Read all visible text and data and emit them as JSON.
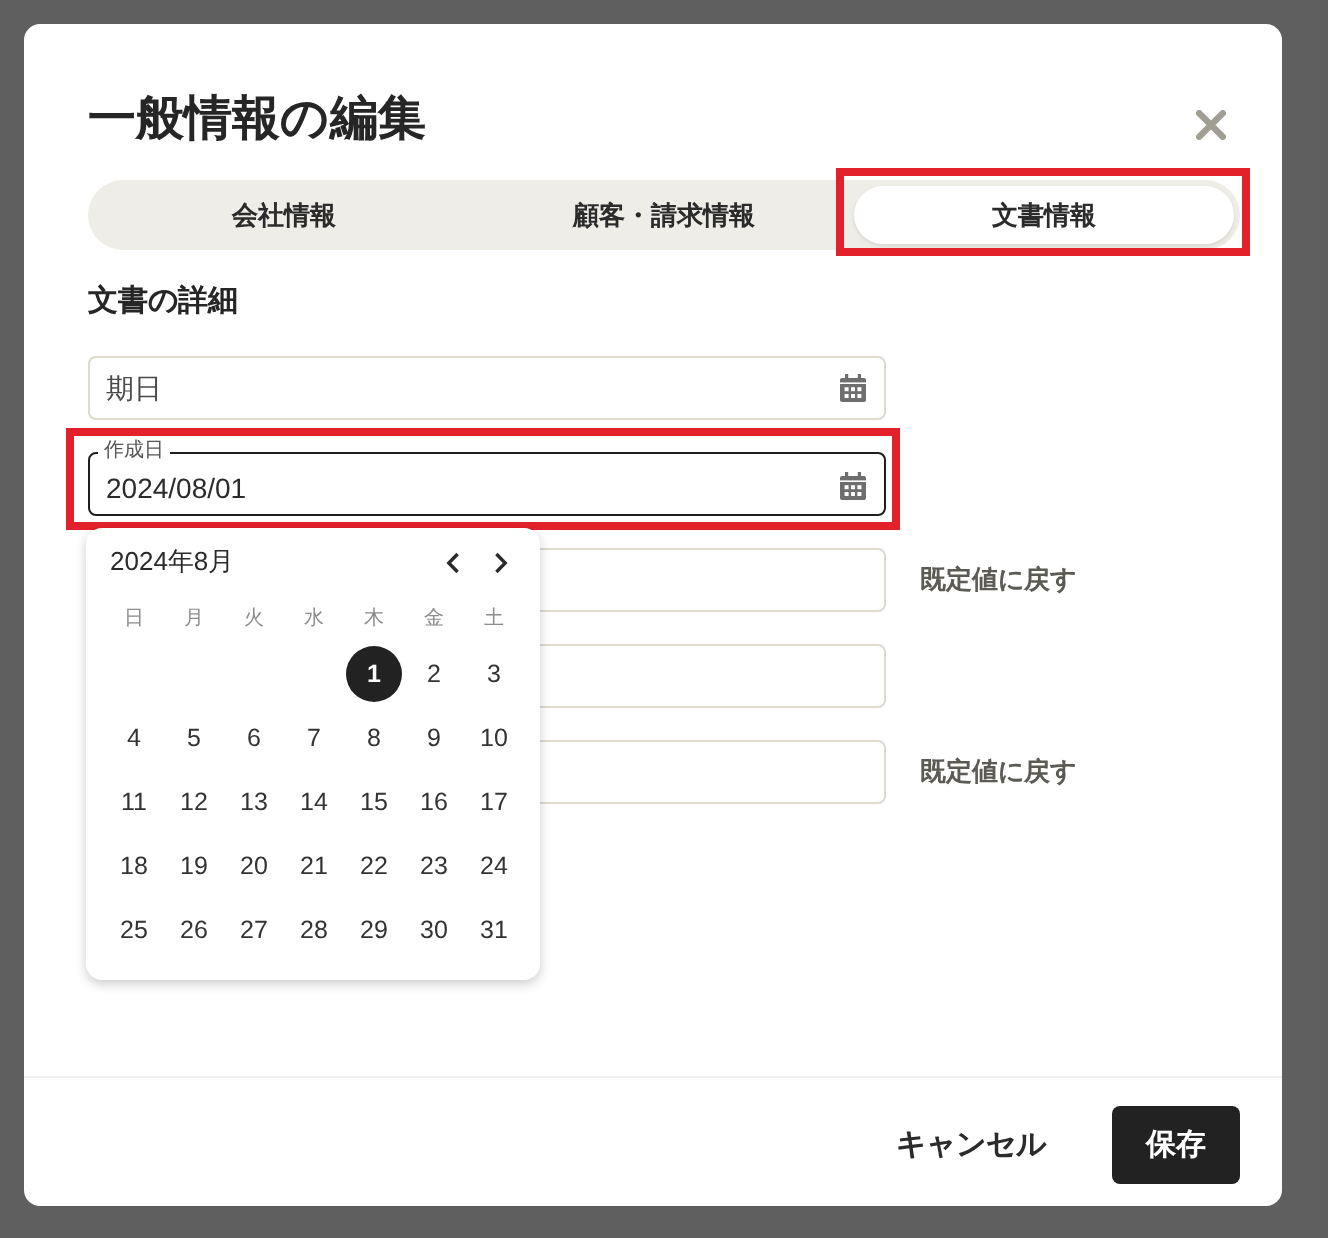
{
  "dialog": {
    "title": "一般情報の編集",
    "tabs": [
      {
        "label": "会社情報",
        "selected": false,
        "highlighted": false
      },
      {
        "label": "顧客・請求情報",
        "selected": false,
        "highlighted": false
      },
      {
        "label": "文書情報",
        "selected": true,
        "highlighted": true
      }
    ],
    "section_title": "文書の詳細",
    "fields": [
      {
        "kind": "date",
        "placeholder": "期日",
        "focused": false,
        "highlighted": false
      },
      {
        "kind": "date",
        "label": "作成日",
        "value": "2024/08/01",
        "focused": true,
        "highlighted": true
      },
      {
        "kind": "text",
        "focused": false,
        "highlighted": false,
        "reset_link": "既定値に戻す"
      },
      {
        "kind": "text",
        "focused": false,
        "highlighted": false
      },
      {
        "kind": "text",
        "focused": false,
        "highlighted": false,
        "reset_link": "既定値に戻す"
      }
    ],
    "date_picker": {
      "month": "2024年8月",
      "weekdays": [
        "日",
        "月",
        "火",
        "水",
        "木",
        "金",
        "土"
      ],
      "weeks": [
        [
          {
            "day": "1",
            "selected": true
          },
          {
            "day": "2",
            "selected": false
          },
          {
            "day": "3",
            "selected": false
          }
        ],
        [
          {
            "day": "4",
            "selected": false
          },
          {
            "day": "5",
            "selected": false
          },
          {
            "day": "6",
            "selected": false
          },
          {
            "day": "7",
            "selected": false
          },
          {
            "day": "8",
            "selected": false
          },
          {
            "day": "9",
            "selected": false
          },
          {
            "day": "10",
            "selected": false
          }
        ],
        [
          {
            "day": "11",
            "selected": false
          },
          {
            "day": "12",
            "selected": false
          },
          {
            "day": "13",
            "selected": false
          },
          {
            "day": "14",
            "selected": false
          },
          {
            "day": "15",
            "selected": false
          },
          {
            "day": "16",
            "selected": false
          },
          {
            "day": "17",
            "selected": false
          }
        ],
        [
          {
            "day": "18",
            "selected": false
          },
          {
            "day": "19",
            "selected": false
          },
          {
            "day": "20",
            "selected": false
          },
          {
            "day": "21",
            "selected": false
          },
          {
            "day": "22",
            "selected": false
          },
          {
            "day": "23",
            "selected": false
          },
          {
            "day": "24",
            "selected": false
          }
        ],
        [
          {
            "day": "25",
            "selected": false
          },
          {
            "day": "26",
            "selected": false
          },
          {
            "day": "27",
            "selected": false
          },
          {
            "day": "28",
            "selected": false
          },
          {
            "day": "29",
            "selected": false
          },
          {
            "day": "30",
            "selected": false
          },
          {
            "day": "31",
            "selected": false
          }
        ]
      ]
    },
    "buttons": [
      {
        "kind": "secondary",
        "label": "キャンセル"
      },
      {
        "kind": "primary",
        "label": "保存"
      }
    ]
  }
}
